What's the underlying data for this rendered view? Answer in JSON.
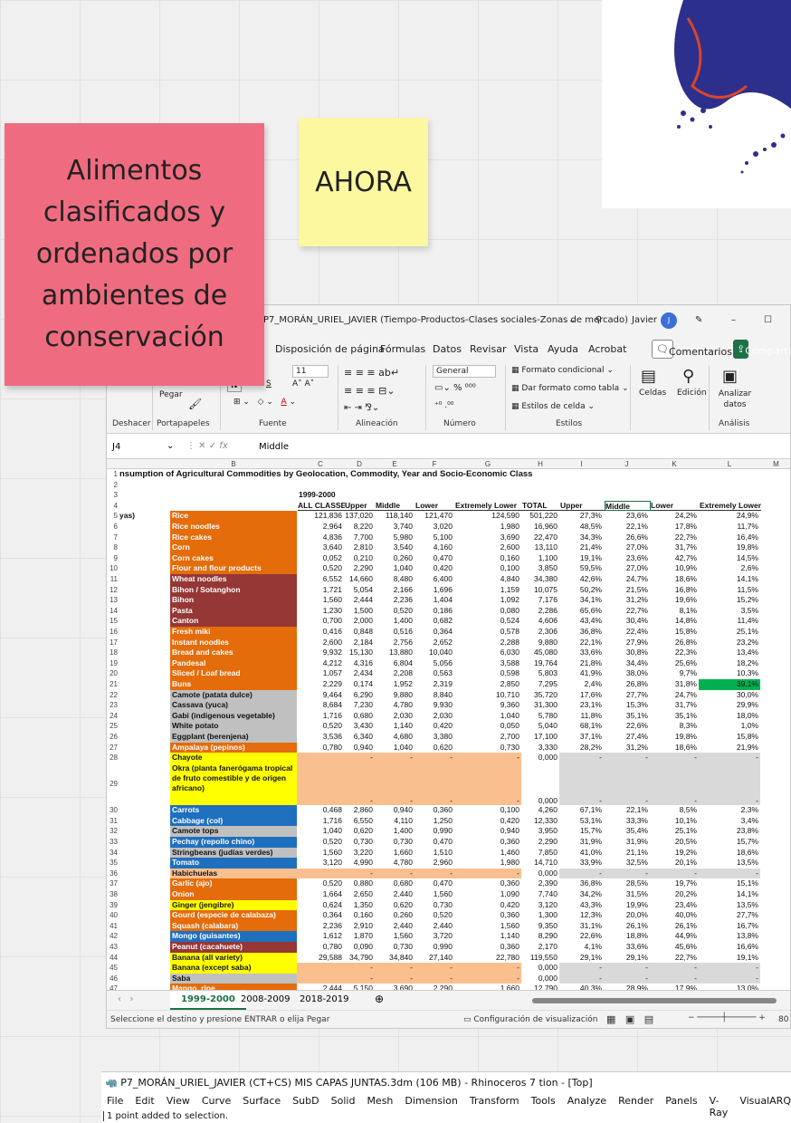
{
  "sticky_notes": {
    "pink": "Alimentos clasificados y ordenados por ambientes de conservación",
    "yellow": "AHORA"
  },
  "excel": {
    "title": "P7_MORÁN_URIEL_JAVIER (Tiempo-Productos-Clases sociales-Zonas de mercado)",
    "user": "Javier",
    "user_initial": "J",
    "tabs": [
      "Disposición de página",
      "Fórmulas",
      "Datos",
      "Revisar",
      "Vista",
      "Ayuda",
      "Acrobat"
    ],
    "comments_btn": "Comentarios",
    "share_btn": "Compartir",
    "ribbon": {
      "paste": "Pegar",
      "font_size": "11",
      "number_format": "General",
      "cond_format": "Formato condicional",
      "table_format": "Dar formato como tabla",
      "cell_styles": "Estilos de celda",
      "cells": "Celdas",
      "edit": "Edición",
      "analyze": "Analizar datos",
      "groups": [
        "Deshacer",
        "Portapapeles",
        "Fuente",
        "Alineación",
        "Número",
        "Estilos",
        "Análisis"
      ]
    },
    "name_box": "J4",
    "formula": "Middle",
    "columns": [
      "B",
      "C",
      "D",
      "E",
      "F",
      "G",
      "H",
      "I",
      "J",
      "K",
      "L",
      "M"
    ],
    "title_row": "nsumption of Agricultural Commodities by Geolocation, Commodity, Year and Socio-Economic Class",
    "year_label": "1999-2000",
    "headers": [
      "ALL CLASSES",
      "Upper",
      "Middle",
      "Lower",
      "Extremely Lower",
      "TOTAL",
      "Upper",
      "Middle",
      "Lower",
      "Extremely Lower"
    ],
    "a_label": "yas)",
    "rows": [
      [
        "Rice",
        "121,836",
        "137,020",
        "118,140",
        "121,470",
        "124,590",
        "501,220",
        "27,3%",
        "23,6%",
        "24,2%",
        "24,9%"
      ],
      [
        "Rice noodles",
        "2,964",
        "8,220",
        "3,740",
        "3,020",
        "1,980",
        "16,960",
        "48,5%",
        "22,1%",
        "17,8%",
        "11,7%"
      ],
      [
        "Rice cakes",
        "4,836",
        "7,700",
        "5,980",
        "5,100",
        "3,690",
        "22,470",
        "34,3%",
        "26,6%",
        "22,7%",
        "16,4%"
      ],
      [
        "Corn",
        "3,640",
        "2,810",
        "3,540",
        "4,160",
        "2,600",
        "13,110",
        "21,4%",
        "27,0%",
        "31,7%",
        "19,8%"
      ],
      [
        "Corn cakes",
        "0,052",
        "0,210",
        "0,260",
        "0,470",
        "0,160",
        "1,100",
        "19,1%",
        "23,6%",
        "42,7%",
        "14,5%"
      ],
      [
        "Flour and flour products",
        "0,520",
        "2,290",
        "1,040",
        "0,420",
        "0,100",
        "3,850",
        "59,5%",
        "27,0%",
        "10,9%",
        "2,6%"
      ],
      [
        "Wheat noodles",
        "6,552",
        "14,660",
        "8,480",
        "6,400",
        "4,840",
        "34,380",
        "42,6%",
        "24,7%",
        "18,6%",
        "14,1%"
      ],
      [
        "Bihon / Sotanghon",
        "1,721",
        "5,054",
        "2,166",
        "1,696",
        "1,159",
        "10,075",
        "50,2%",
        "21,5%",
        "16,8%",
        "11,5%"
      ],
      [
        "Bihon",
        "1,560",
        "2,444",
        "2,236",
        "1,404",
        "1,092",
        "7,176",
        "34,1%",
        "31,2%",
        "19,6%",
        "15,2%"
      ],
      [
        "Pasta",
        "1,230",
        "1,500",
        "0,520",
        "0,186",
        "0,080",
        "2,286",
        "65,6%",
        "22,7%",
        "8,1%",
        "3,5%"
      ],
      [
        "Canton",
        "0,700",
        "2,000",
        "1,400",
        "0,682",
        "0,524",
        "4,606",
        "43,4%",
        "30,4%",
        "14,8%",
        "11,4%"
      ],
      [
        "Fresh miki",
        "0,416",
        "0,848",
        "0,516",
        "0,364",
        "0,578",
        "2,306",
        "36,8%",
        "22,4%",
        "15,8%",
        "25,1%"
      ],
      [
        "Instant noodles",
        "2,600",
        "2,184",
        "2,756",
        "2,652",
        "2,288",
        "9,880",
        "22,1%",
        "27,9%",
        "26,8%",
        "23,2%"
      ],
      [
        "Bread and cakes",
        "9,932",
        "15,130",
        "13,880",
        "10,040",
        "6,030",
        "45,080",
        "33,6%",
        "30,8%",
        "22,3%",
        "13,4%"
      ],
      [
        "Pandesal",
        "4,212",
        "4,316",
        "6,804",
        "5,056",
        "3,588",
        "19,764",
        "21,8%",
        "34,4%",
        "25,6%",
        "18,2%"
      ],
      [
        "Sliced / Loaf bread",
        "1,057",
        "2,434",
        "2,208",
        "0,563",
        "0,598",
        "5,803",
        "41,9%",
        "38,0%",
        "9,7%",
        "10,3%"
      ],
      [
        "Buns",
        "2,229",
        "0,174",
        "1,952",
        "2,319",
        "2,850",
        "7,295",
        "2,4%",
        "26,8%",
        "31,8%",
        "39,1%"
      ],
      [
        "Camote (patata dulce)",
        "9,464",
        "6,290",
        "9,880",
        "8,840",
        "10,710",
        "35,720",
        "17,6%",
        "27,7%",
        "24,7%",
        "30,0%"
      ],
      [
        "Cassava (yuca)",
        "8,684",
        "7,230",
        "4,780",
        "9,930",
        "9,360",
        "31,300",
        "23,1%",
        "15,3%",
        "31,7%",
        "29,9%"
      ],
      [
        "Gabi (indigenous vegetable)",
        "1,716",
        "0,680",
        "2,030",
        "2,030",
        "1,040",
        "5,780",
        "11,8%",
        "35,1%",
        "35,1%",
        "18,0%"
      ],
      [
        "White potato",
        "0,520",
        "3,430",
        "1,140",
        "0,420",
        "0,050",
        "5,040",
        "68,1%",
        "22,6%",
        "8,3%",
        "1,0%"
      ],
      [
        "Eggplant (berenjena)",
        "3,536",
        "6,340",
        "4,680",
        "3,380",
        "2,700",
        "17,100",
        "37,1%",
        "27,4%",
        "19,8%",
        "15,8%"
      ],
      [
        "Ampalaya (pepinos)",
        "0,780",
        "0,940",
        "1,040",
        "0,620",
        "0,730",
        "3,330",
        "28,2%",
        "31,2%",
        "18,6%",
        "21,9%"
      ],
      [
        "Chayote",
        "",
        "-",
        "-",
        "-",
        "-",
        "0,000",
        "-",
        "-",
        "-",
        "-"
      ],
      [
        "Okra (planta fanerógama tropical de fruto comestible y de origen africano)",
        "",
        "-",
        "-",
        "-",
        "-",
        "0,000",
        "-",
        "-",
        "-",
        "-"
      ],
      [
        "Carrots",
        "0,468",
        "2,860",
        "0,940",
        "0,360",
        "0,100",
        "4,260",
        "67,1%",
        "22,1%",
        "8,5%",
        "2,3%"
      ],
      [
        "Cabbage (col)",
        "1,716",
        "6,550",
        "4,110",
        "1,250",
        "0,420",
        "12,330",
        "53,1%",
        "33,3%",
        "10,1%",
        "3,4%"
      ],
      [
        "Camote tops",
        "1,040",
        "0,620",
        "1,400",
        "0,990",
        "0,940",
        "3,950",
        "15,7%",
        "35,4%",
        "25,1%",
        "23,8%"
      ],
      [
        "Pechay (repollo chino)",
        "0,520",
        "0,730",
        "0,730",
        "0,470",
        "0,360",
        "2,290",
        "31,9%",
        "31,9%",
        "20,5%",
        "15,7%"
      ],
      [
        "Stringbeans (judías verdes)",
        "1,560",
        "3,220",
        "1,660",
        "1,510",
        "1,460",
        "7,850",
        "41,0%",
        "21,1%",
        "19,2%",
        "18,6%"
      ],
      [
        "Tomato",
        "3,120",
        "4,990",
        "4,780",
        "2,960",
        "1,980",
        "14,710",
        "33,9%",
        "32,5%",
        "20,1%",
        "13,5%"
      ],
      [
        "Habichuelas",
        "",
        "-",
        "-",
        "-",
        "-",
        "0,000",
        "-",
        "-",
        "-",
        "-"
      ],
      [
        "Garlic (ajo)",
        "0,520",
        "0,880",
        "0,680",
        "0,470",
        "0,360",
        "2,390",
        "36,8%",
        "28,5%",
        "19,7%",
        "15,1%"
      ],
      [
        "Onion",
        "1,664",
        "2,650",
        "2,440",
        "1,560",
        "1,090",
        "7,740",
        "34,2%",
        "31,5%",
        "20,2%",
        "14,1%"
      ],
      [
        "Ginger (jengibre)",
        "0,624",
        "1,350",
        "0,620",
        "0,730",
        "0,420",
        "3,120",
        "43,3%",
        "19,9%",
        "23,4%",
        "13,5%"
      ],
      [
        "Gourd (especie de calabaza)",
        "0,364",
        "0,160",
        "0,260",
        "0,520",
        "0,360",
        "1,300",
        "12,3%",
        "20,0%",
        "40,0%",
        "27,7%"
      ],
      [
        "Squash (calabara)",
        "2,236",
        "2,910",
        "2,440",
        "2,440",
        "1,560",
        "9,350",
        "31,1%",
        "26,1%",
        "26,1%",
        "16,7%"
      ],
      [
        "Mongo (guisantes)",
        "1,612",
        "1,870",
        "1,560",
        "3,720",
        "1,140",
        "8,290",
        "22,6%",
        "18,8%",
        "44,9%",
        "13,8%"
      ],
      [
        "Peanut (cacahuete)",
        "0,780",
        "0,090",
        "0,730",
        "0,990",
        "0,360",
        "2,170",
        "4,1%",
        "33,6%",
        "45,6%",
        "16,6%"
      ],
      [
        "Banana (all variety)",
        "29,588",
        "34,790",
        "34,840",
        "27,140",
        "22,780",
        "119,550",
        "29,1%",
        "29,1%",
        "22,7%",
        "19,1%"
      ],
      [
        "Banana (except saba)",
        "",
        "-",
        "-",
        "-",
        "-",
        "0,000",
        "-",
        "-",
        "-",
        "-"
      ],
      [
        "Saba",
        "",
        "-",
        "-",
        "-",
        "-",
        "0,000",
        "-",
        "-",
        "-",
        "-"
      ],
      [
        "Mango, ripe",
        "2,444",
        "5,150",
        "3,690",
        "2,290",
        "1,660",
        "12,790",
        "40,3%",
        "28,9%",
        "17,9%",
        "13,0%"
      ]
    ],
    "row_colors": [
      "#e46c0a",
      "#e46c0a",
      "#e46c0a",
      "#e46c0a",
      "#e46c0a",
      "#e46c0a",
      "#953735",
      "#953735",
      "#953735",
      "#953735",
      "#953735",
      "#e46c0a",
      "#e46c0a",
      "#e46c0a",
      "#e46c0a",
      "#e46c0a",
      "#e46c0a",
      "#c0c0c0",
      "#c0c0c0",
      "#c0c0c0",
      "#c0c0c0",
      "#c0c0c0",
      "#e46c0a",
      "#ffff00",
      "#ffff00",
      "#1f6fbf",
      "#1f6fbf",
      "#c0c0c0",
      "#1f6fbf",
      "#c0c0c0",
      "#1f6fbf",
      "#fabf8f",
      "#e46c0a",
      "#e46c0a",
      "#ffff00",
      "#e46c0a",
      "#e46c0a",
      "#1f6fbf",
      "#953735",
      "#ffff00",
      "#ffff00",
      "#c0c0c0",
      "#e46c0a"
    ],
    "sheet_tabs": [
      "1999-2000",
      "2008-2009",
      "2018-2019"
    ],
    "status": "Seleccione el destino y presione ENTRAR o elija Pegar",
    "display_settings": "Configuración de visualización",
    "zoom": "80"
  },
  "rhino": {
    "title": "P7_MORÁN_URIEL_JAVIER (CT+CS) MIS CAPAS JUNTAS.3dm (106 MB) - Rhinoceros 7 tion - [Top]",
    "menu": [
      "File",
      "Edit",
      "View",
      "Curve",
      "Surface",
      "SubD",
      "Solid",
      "Mesh",
      "Dimension",
      "Transform",
      "Tools",
      "Analyze",
      "Render",
      "Panels",
      "V-Ray",
      "VisualARQ",
      "Help"
    ],
    "command": "1 point added to selection."
  }
}
